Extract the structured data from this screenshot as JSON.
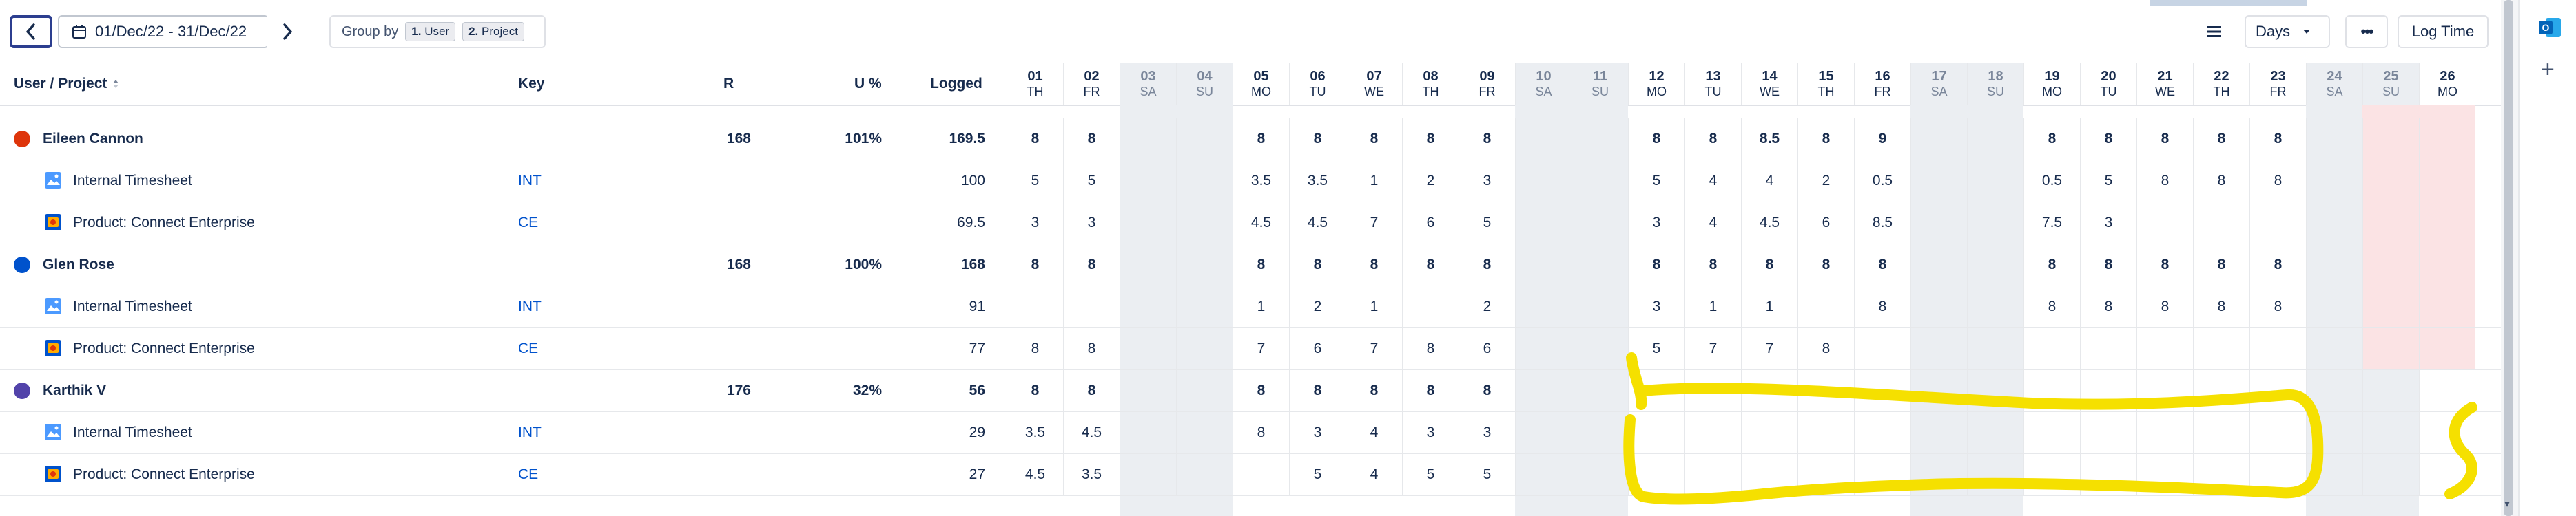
{
  "toolbar": {
    "prev_label": "‹",
    "next_label": "›",
    "date_range": "01/Dec/22 - 31/Dec/22",
    "group_by_label": "Group by",
    "group_chips": [
      {
        "num": "1.",
        "label": "User"
      },
      {
        "num": "2.",
        "label": "Project"
      }
    ],
    "view_select": "Days",
    "more_label": "•••",
    "log_time_label": "Log Time"
  },
  "columns": {
    "user_project": "User / Project",
    "sort_icon": "sort-asc-icon",
    "key": "Key",
    "r": "R",
    "u": "U %",
    "logged": "Logged"
  },
  "days": [
    {
      "d": "01",
      "w": "TH",
      "weekend": false
    },
    {
      "d": "02",
      "w": "FR",
      "weekend": false
    },
    {
      "d": "03",
      "w": "SA",
      "weekend": true
    },
    {
      "d": "04",
      "w": "SU",
      "weekend": true
    },
    {
      "d": "05",
      "w": "MO",
      "weekend": false
    },
    {
      "d": "06",
      "w": "TU",
      "weekend": false
    },
    {
      "d": "07",
      "w": "WE",
      "weekend": false
    },
    {
      "d": "08",
      "w": "TH",
      "weekend": false
    },
    {
      "d": "09",
      "w": "FR",
      "weekend": false
    },
    {
      "d": "10",
      "w": "SA",
      "weekend": true
    },
    {
      "d": "11",
      "w": "SU",
      "weekend": true
    },
    {
      "d": "12",
      "w": "MO",
      "weekend": false
    },
    {
      "d": "13",
      "w": "TU",
      "weekend": false
    },
    {
      "d": "14",
      "w": "WE",
      "weekend": false
    },
    {
      "d": "15",
      "w": "TH",
      "weekend": false
    },
    {
      "d": "16",
      "w": "FR",
      "weekend": false
    },
    {
      "d": "17",
      "w": "SA",
      "weekend": true
    },
    {
      "d": "18",
      "w": "SU",
      "weekend": true
    },
    {
      "d": "19",
      "w": "MO",
      "weekend": false
    },
    {
      "d": "20",
      "w": "TU",
      "weekend": false
    },
    {
      "d": "21",
      "w": "WE",
      "weekend": false
    },
    {
      "d": "22",
      "w": "TH",
      "weekend": false
    },
    {
      "d": "23",
      "w": "FR",
      "weekend": false
    },
    {
      "d": "24",
      "w": "SA",
      "weekend": true
    },
    {
      "d": "25",
      "w": "SU",
      "weekend": true
    },
    {
      "d": "26",
      "w": "MO",
      "weekend": false
    }
  ],
  "rows": [
    {
      "type": "user",
      "name": "Eileen Cannon",
      "avatar_color": "#de350b",
      "r": "168",
      "u": "101%",
      "logged": "169.5",
      "cells": [
        "8",
        "8",
        "",
        "",
        "8",
        "8",
        "8",
        "8",
        "8",
        "",
        "",
        "8",
        "8",
        "8.5",
        "8",
        "9",
        "",
        "",
        "8",
        "8",
        "8",
        "8",
        "8",
        "",
        "",
        ""
      ]
    },
    {
      "type": "project",
      "name": "Internal Timesheet",
      "icon": "image-icon",
      "key": "INT",
      "logged": "100",
      "cells": [
        "5",
        "5",
        "",
        "",
        "3.5",
        "3.5",
        "1",
        "2",
        "3",
        "",
        "",
        "5",
        "4",
        "4",
        "2",
        "0.5",
        "",
        "",
        "0.5",
        "5",
        "8",
        "8",
        "8",
        "",
        "",
        ""
      ]
    },
    {
      "type": "project",
      "name": "Product: Connect Enterprise",
      "icon": "project-icon",
      "key": "CE",
      "logged": "69.5",
      "cells": [
        "3",
        "3",
        "",
        "",
        "4.5",
        "4.5",
        "7",
        "6",
        "5",
        "",
        "",
        "3",
        "4",
        "4.5",
        "6",
        "8.5",
        "",
        "",
        "7.5",
        "3",
        "",
        "",
        "",
        "",
        "",
        ""
      ]
    },
    {
      "type": "user",
      "name": "Glen Rose",
      "avatar_color": "#0052cc",
      "r": "168",
      "u": "100%",
      "logged": "168",
      "cells": [
        "8",
        "8",
        "",
        "",
        "8",
        "8",
        "8",
        "8",
        "8",
        "",
        "",
        "8",
        "8",
        "8",
        "8",
        "8",
        "",
        "",
        "8",
        "8",
        "8",
        "8",
        "8",
        "",
        "",
        ""
      ]
    },
    {
      "type": "project",
      "name": "Internal Timesheet",
      "icon": "image-icon",
      "key": "INT",
      "logged": "91",
      "cells": [
        "",
        "",
        "",
        "",
        "1",
        "2",
        "1",
        "",
        "2",
        "",
        "",
        "3",
        "1",
        "1",
        "",
        "8",
        "",
        "",
        "8",
        "8",
        "8",
        "8",
        "8",
        "",
        "",
        ""
      ]
    },
    {
      "type": "project",
      "name": "Product: Connect Enterprise",
      "icon": "project-icon",
      "key": "CE",
      "logged": "77",
      "cells": [
        "8",
        "8",
        "",
        "",
        "7",
        "6",
        "7",
        "8",
        "6",
        "",
        "",
        "5",
        "7",
        "7",
        "8",
        "",
        "",
        "",
        "",
        "",
        "",
        "",
        "",
        "",
        "",
        ""
      ]
    },
    {
      "type": "user",
      "name": "Karthik V",
      "avatar_color": "#5243aa",
      "r": "176",
      "u": "32%",
      "logged": "56",
      "cells": [
        "8",
        "8",
        "",
        "",
        "8",
        "8",
        "8",
        "8",
        "8",
        "",
        "",
        "",
        "",
        "",
        "",
        "",
        "",
        "",
        "",
        "",
        "",
        "",
        "",
        "",
        "",
        ""
      ]
    },
    {
      "type": "project",
      "name": "Internal Timesheet",
      "icon": "image-icon",
      "key": "INT",
      "logged": "29",
      "cells": [
        "3.5",
        "4.5",
        "",
        "",
        "8",
        "3",
        "4",
        "3",
        "3",
        "",
        "",
        "",
        "",
        "",
        "",
        "",
        "",
        "",
        "",
        "",
        "",
        "",
        "",
        "",
        "",
        ""
      ]
    },
    {
      "type": "project",
      "name": "Product: Connect Enterprise",
      "icon": "project-icon",
      "key": "CE",
      "logged": "27",
      "cells": [
        "4.5",
        "3.5",
        "",
        "",
        "",
        "5",
        "4",
        "5",
        "5",
        "",
        "",
        "",
        "",
        "",
        "",
        "",
        "",
        "",
        "",
        "",
        "",
        "",
        "",
        "",
        "",
        ""
      ]
    }
  ],
  "colors": {
    "accent": "#2c3e8f",
    "link": "#0052cc",
    "weekend": "#ebeef2",
    "overage": "#fbe3e4",
    "annotation": "#f5e000"
  }
}
